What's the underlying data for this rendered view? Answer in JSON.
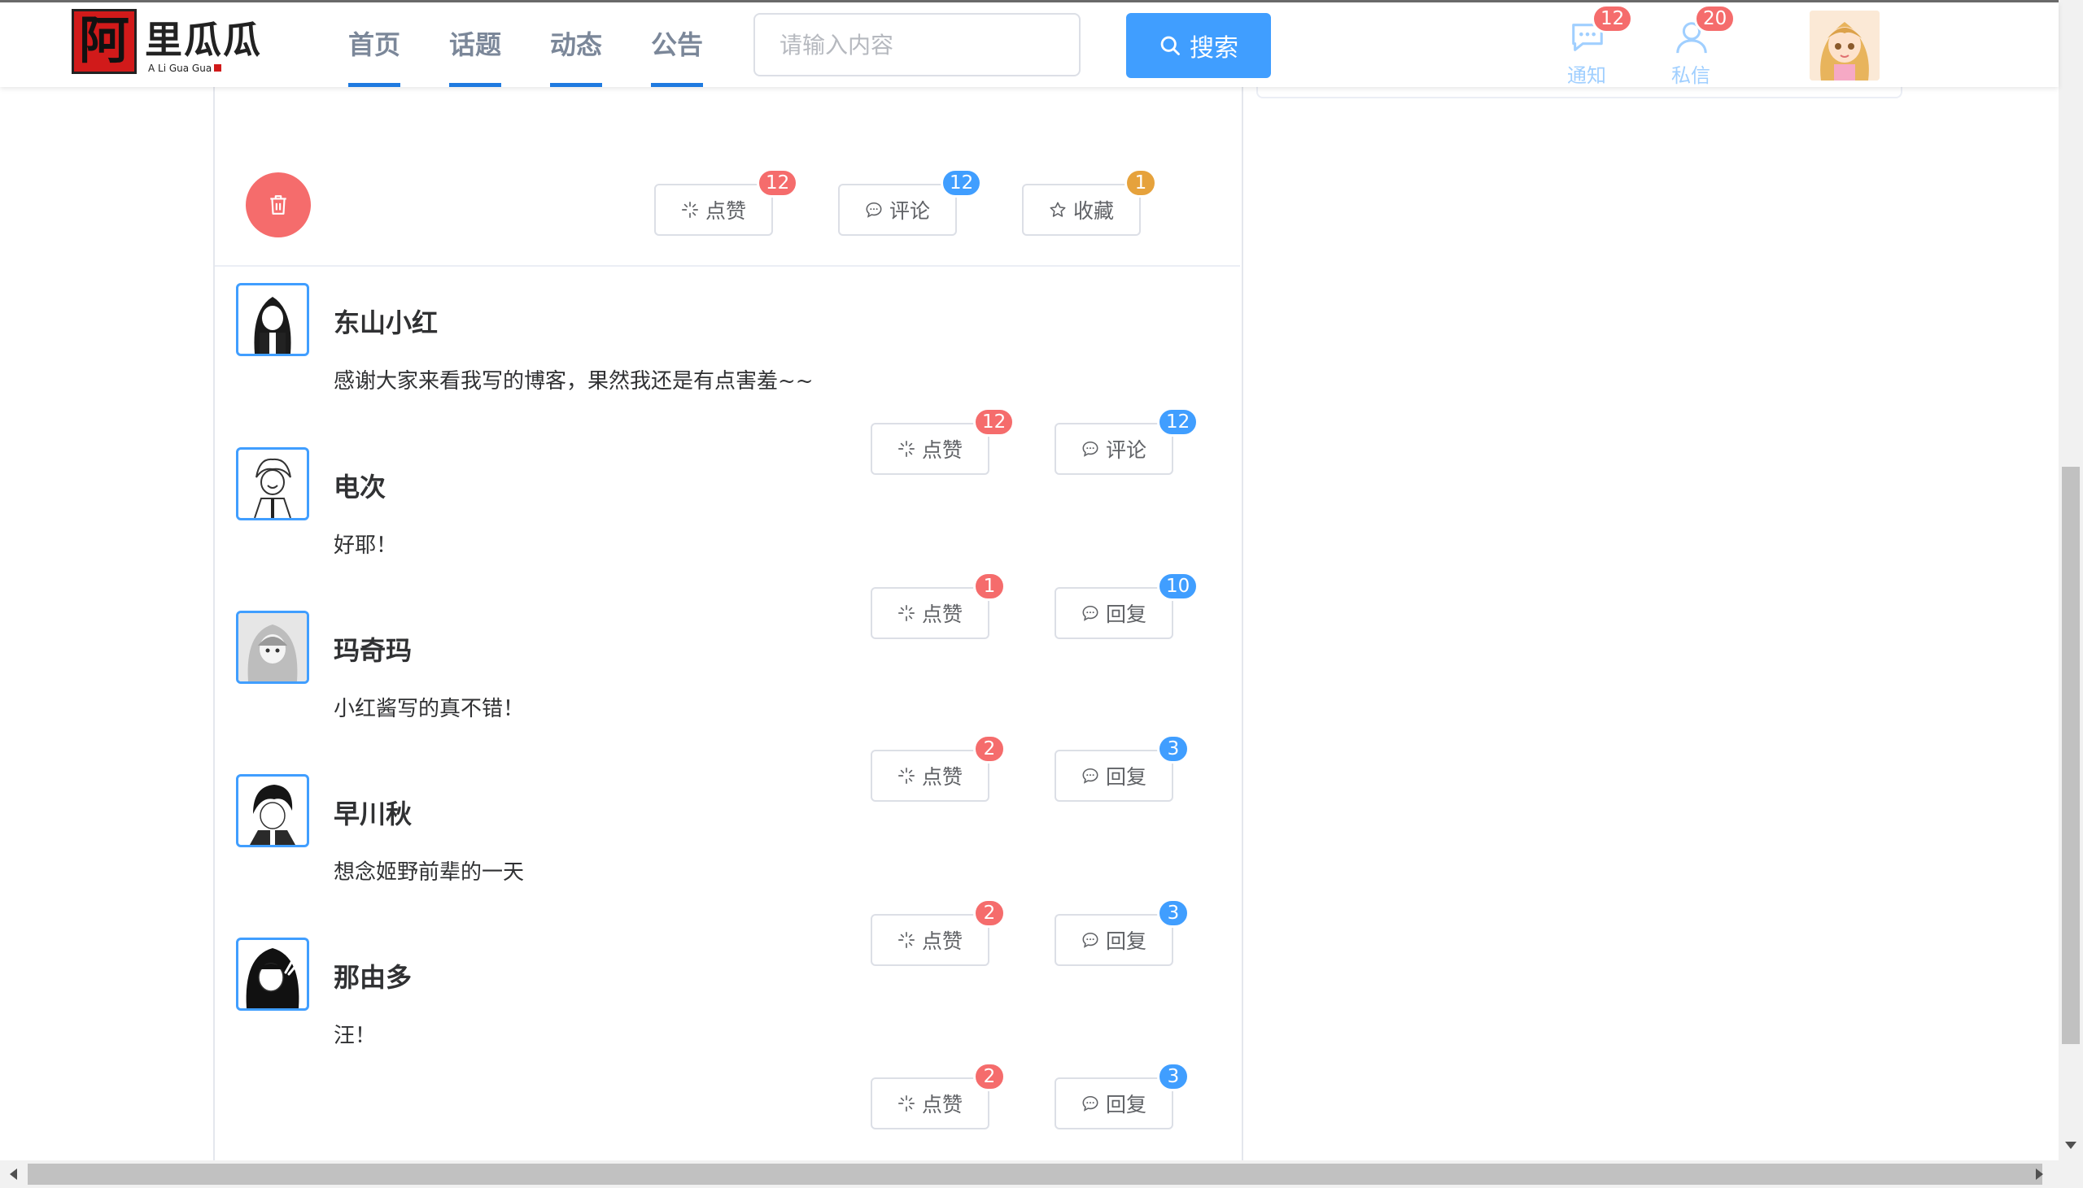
{
  "header": {
    "logo": {
      "main_text": "里瓜瓜",
      "box_char": "阿",
      "sub_text": "A Li Gua Gua"
    },
    "nav": [
      {
        "label": "首页"
      },
      {
        "label": "话题"
      },
      {
        "label": "动态"
      },
      {
        "label": "公告"
      }
    ],
    "search": {
      "placeholder": "请输入内容",
      "button_label": "搜索"
    },
    "notifications": {
      "label": "通知",
      "count": "12"
    },
    "messages": {
      "label": "私信",
      "count": "20"
    },
    "colors": {
      "accent": "#409eff",
      "nav_underline": "#1f7ae0",
      "danger": "#f56c6c",
      "warning": "#e6a23c"
    }
  },
  "post_actions": {
    "like": {
      "label": "点赞",
      "count": "12"
    },
    "comment": {
      "label": "评论",
      "count": "12"
    },
    "favorite": {
      "label": "收藏",
      "count": "1"
    }
  },
  "comments": [
    {
      "name": "东山小红",
      "text": "感谢大家来看我写的博客，果然我还是有点害羞~~",
      "like": {
        "label": "点赞",
        "count": "12"
      },
      "reply": {
        "label": "评论",
        "count": "12"
      }
    },
    {
      "name": "电次",
      "text": "好耶！",
      "like": {
        "label": "点赞",
        "count": "1"
      },
      "reply": {
        "label": "回复",
        "count": "10"
      }
    },
    {
      "name": "玛奇玛",
      "text": "小红酱写的真不错！",
      "like": {
        "label": "点赞",
        "count": "2"
      },
      "reply": {
        "label": "回复",
        "count": "3"
      }
    },
    {
      "name": "早川秋",
      "text": "想念姬野前辈的一天",
      "like": {
        "label": "点赞",
        "count": "2"
      },
      "reply": {
        "label": "回复",
        "count": "3"
      }
    },
    {
      "name": "那由多",
      "text": "汪！",
      "like": {
        "label": "点赞",
        "count": "2"
      },
      "reply": {
        "label": "回复",
        "count": "3"
      }
    }
  ]
}
